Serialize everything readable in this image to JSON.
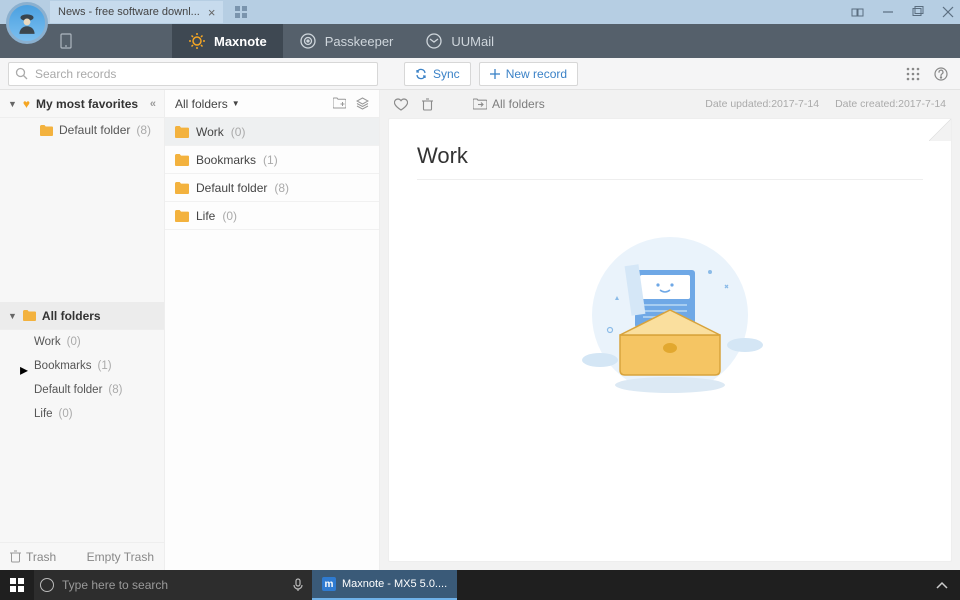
{
  "window": {
    "tab_title": "News - free software downl...",
    "tab_close": "×"
  },
  "nav": {
    "maxnote": "Maxnote",
    "passkeeper": "Passkeeper",
    "uumail": "UUMail"
  },
  "toolbar": {
    "search_placeholder": "Search records",
    "sync_label": "Sync",
    "new_record_label": "New record"
  },
  "sidebar": {
    "favorites_header": "My most favorites",
    "favorites": [
      {
        "label": "Default folder",
        "count": "(8)"
      }
    ],
    "all_folders_header": "All folders",
    "all_folders": [
      {
        "label": "Work",
        "count": "(0)"
      },
      {
        "label": "Bookmarks",
        "count": "(1)",
        "has_children": true
      },
      {
        "label": "Default folder",
        "count": "(8)"
      },
      {
        "label": "Life",
        "count": "(0)"
      }
    ],
    "trash_label": "Trash",
    "empty_trash_label": "Empty Trash"
  },
  "folder_list": {
    "header": "All folders",
    "items": [
      {
        "label": "Work",
        "count": "(0)",
        "selected": true
      },
      {
        "label": "Bookmarks",
        "count": "(1)"
      },
      {
        "label": "Default folder",
        "count": "(8)"
      },
      {
        "label": "Life",
        "count": "(0)"
      }
    ]
  },
  "detail": {
    "breadcrumb": "All folders",
    "date_updated_label": "Date updated:",
    "date_updated_value": "2017-7-14",
    "date_created_label": "Date created:",
    "date_created_value": "2017-7-14",
    "title": "Work"
  },
  "taskbar": {
    "search_placeholder": "Type here to search",
    "task_item_label": "Maxnote - MX5 5.0....",
    "app_initial": "m"
  }
}
